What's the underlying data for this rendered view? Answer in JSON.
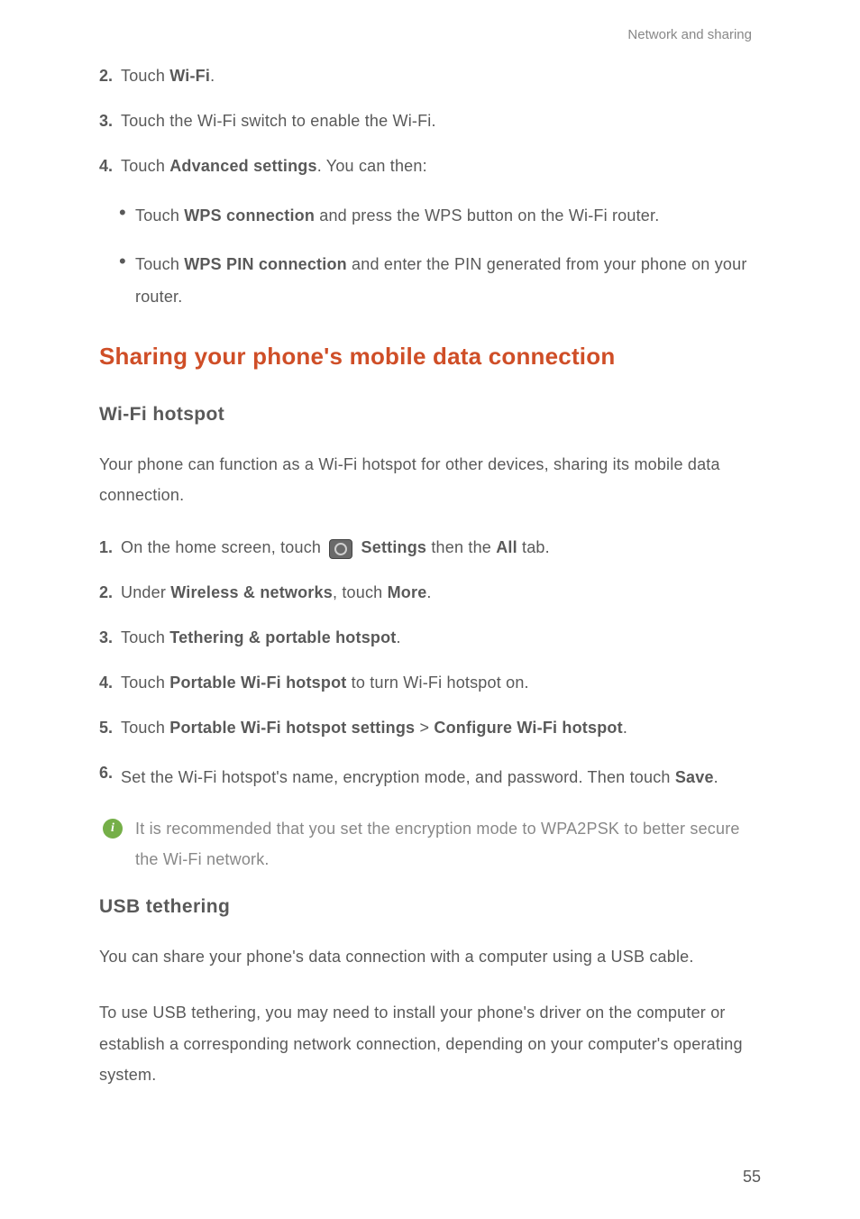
{
  "header": {
    "section": "Network and sharing"
  },
  "items_top": [
    {
      "marker": "2.",
      "prefix": "Touch ",
      "bold": "Wi-Fi",
      "suffix": "."
    },
    {
      "marker": "3.",
      "prefix": "Touch the Wi-Fi switch to enable the Wi-Fi.",
      "bold": "",
      "suffix": ""
    },
    {
      "marker": "4.",
      "prefix": "Touch ",
      "bold": "Advanced settings",
      "suffix": ". You can then:"
    }
  ],
  "bullets": [
    {
      "prefix": "Touch ",
      "bold": "WPS connection",
      "suffix": " and press the WPS button on the Wi-Fi router."
    },
    {
      "prefix": "Touch ",
      "bold": "WPS PIN connection",
      "suffix": " and enter the PIN generated from your phone on your router."
    }
  ],
  "h1": "Sharing your phone's mobile data connection",
  "h2a": "Wi-Fi  hotspot",
  "p1": "Your phone can function as a Wi-Fi hotspot for other devices, sharing its mobile data connection.",
  "steps": {
    "s1_marker": "1.",
    "s1_a": "On the home screen, touch ",
    "s1_b": "Settings",
    "s1_c": " then the ",
    "s1_d": "All",
    "s1_e": " tab.",
    "s2": {
      "marker": "2.",
      "a": "Under ",
      "b": "Wireless & networks",
      "c": ", touch ",
      "d": "More",
      "e": "."
    },
    "s3": {
      "marker": "3.",
      "a": "Touch ",
      "b": "Tethering & portable hotspot",
      "c": "."
    },
    "s4": {
      "marker": "4.",
      "a": "Touch ",
      "b": "Portable Wi-Fi hotspot",
      "c": " to turn Wi-Fi hotspot on."
    },
    "s5": {
      "marker": "5.",
      "a": "Touch ",
      "b": "Portable Wi-Fi hotspot settings",
      "c": " > ",
      "d": "Configure Wi-Fi hotspot",
      "e": "."
    },
    "s6": {
      "marker": "6.",
      "a": "Set the Wi-Fi hotspot's name, encryption mode, and password. Then touch ",
      "b": "Save",
      "c": "."
    }
  },
  "info": {
    "badge": "i",
    "text": "It is recommended that you set the encryption mode to WPA2PSK to better secure the Wi-Fi network."
  },
  "h2b": "USB  tethering",
  "p2": "You can share your phone's data connection with a computer using a USB cable.",
  "p3": "To use USB tethering, you may need to install your phone's driver on the computer or establish a corresponding network connection, depending on your computer's operating system.",
  "page": "55"
}
